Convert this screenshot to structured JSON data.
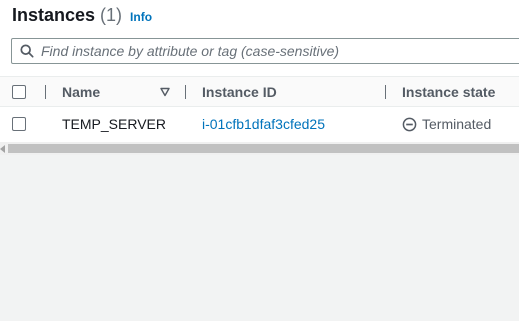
{
  "header": {
    "title": "Instances",
    "count": "(1)",
    "info_label": "Info"
  },
  "search": {
    "placeholder": "Find instance by attribute or tag (case-sensitive)",
    "value": "",
    "icon": "search-icon"
  },
  "table": {
    "columns": [
      {
        "label": "Name",
        "sortable": true
      },
      {
        "label": "Instance ID"
      },
      {
        "label": "Instance state"
      }
    ],
    "rows": [
      {
        "selected": false,
        "name": "TEMP_SERVER",
        "instance_id": "i-01cfb1dfaf3cfed25",
        "state": "Terminated",
        "state_icon": "terminated-icon"
      }
    ]
  },
  "colors": {
    "link": "#0073bb",
    "muted": "#687078",
    "heading": "#16191f"
  }
}
